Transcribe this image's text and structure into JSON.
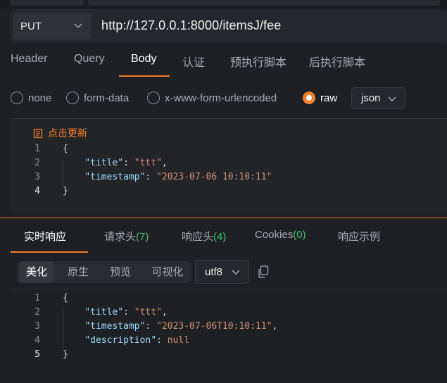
{
  "request": {
    "method": "PUT",
    "url": "http://127.0.0.1:8000/itemsJ/fee"
  },
  "request_tabs": [
    "Header",
    "Query",
    "Body",
    "认证",
    "预执行脚本",
    "后执行脚本"
  ],
  "active_request_tab": "Body",
  "body_types": [
    "none",
    "form-data",
    "x-www-form-urlencoded",
    "raw"
  ],
  "selected_body_type": "raw",
  "body_format": "json",
  "update_link": "点击更新",
  "request_body": {
    "line_numbers": [
      "1",
      "2",
      "3",
      "4"
    ],
    "lines": [
      {
        "indent": "",
        "parts": [
          {
            "t": "{",
            "c": "punc"
          }
        ]
      },
      {
        "indent": "    ",
        "parts": [
          {
            "t": "\"title\"",
            "c": "key"
          },
          {
            "t": ": ",
            "c": "punc"
          },
          {
            "t": "\"ttt\"",
            "c": "str"
          },
          {
            "t": ",",
            "c": "punc"
          }
        ]
      },
      {
        "indent": "    ",
        "parts": [
          {
            "t": "\"timestamp\"",
            "c": "key"
          },
          {
            "t": ": ",
            "c": "punc"
          },
          {
            "t": "\"2023-07-06 10:10:11\"",
            "c": "str"
          }
        ]
      },
      {
        "indent": "",
        "parts": [
          {
            "t": "}",
            "c": "punc"
          }
        ]
      }
    ]
  },
  "response_tabs": [
    {
      "label": "实时响应",
      "count": ""
    },
    {
      "label": "请求头",
      "count": "(7)"
    },
    {
      "label": "响应头",
      "count": "(4)"
    },
    {
      "label": "Cookies",
      "count": "(0)"
    },
    {
      "label": "响应示例",
      "count": ""
    }
  ],
  "active_response_tab": "实时响应",
  "view_modes": [
    "美化",
    "原生",
    "预览",
    "可视化"
  ],
  "active_view_mode": "美化",
  "encoding": "utf8",
  "response_body": {
    "line_numbers": [
      "1",
      "2",
      "3",
      "4",
      "5"
    ],
    "lines": [
      {
        "indent": "",
        "parts": [
          {
            "t": "{",
            "c": "punc"
          }
        ]
      },
      {
        "indent": "    ",
        "parts": [
          {
            "t": "\"title\"",
            "c": "key"
          },
          {
            "t": ": ",
            "c": "punc"
          },
          {
            "t": "\"ttt\"",
            "c": "str"
          },
          {
            "t": ",",
            "c": "punc"
          }
        ]
      },
      {
        "indent": "    ",
        "parts": [
          {
            "t": "\"timestamp\"",
            "c": "key"
          },
          {
            "t": ": ",
            "c": "punc"
          },
          {
            "t": "\"2023-07-06T10:10:11\"",
            "c": "str"
          },
          {
            "t": ",",
            "c": "punc"
          }
        ]
      },
      {
        "indent": "    ",
        "parts": [
          {
            "t": "\"description\"",
            "c": "key"
          },
          {
            "t": ": ",
            "c": "punc"
          },
          {
            "t": "null",
            "c": "nul"
          }
        ]
      },
      {
        "indent": "",
        "parts": [
          {
            "t": "}",
            "c": "punc"
          }
        ]
      }
    ]
  },
  "colors": {
    "accent": "#f0802e",
    "count_green": "#3fbf6f",
    "json_key": "#9cdcfe",
    "json_string": "#ce9178",
    "background": "#1f2024"
  }
}
